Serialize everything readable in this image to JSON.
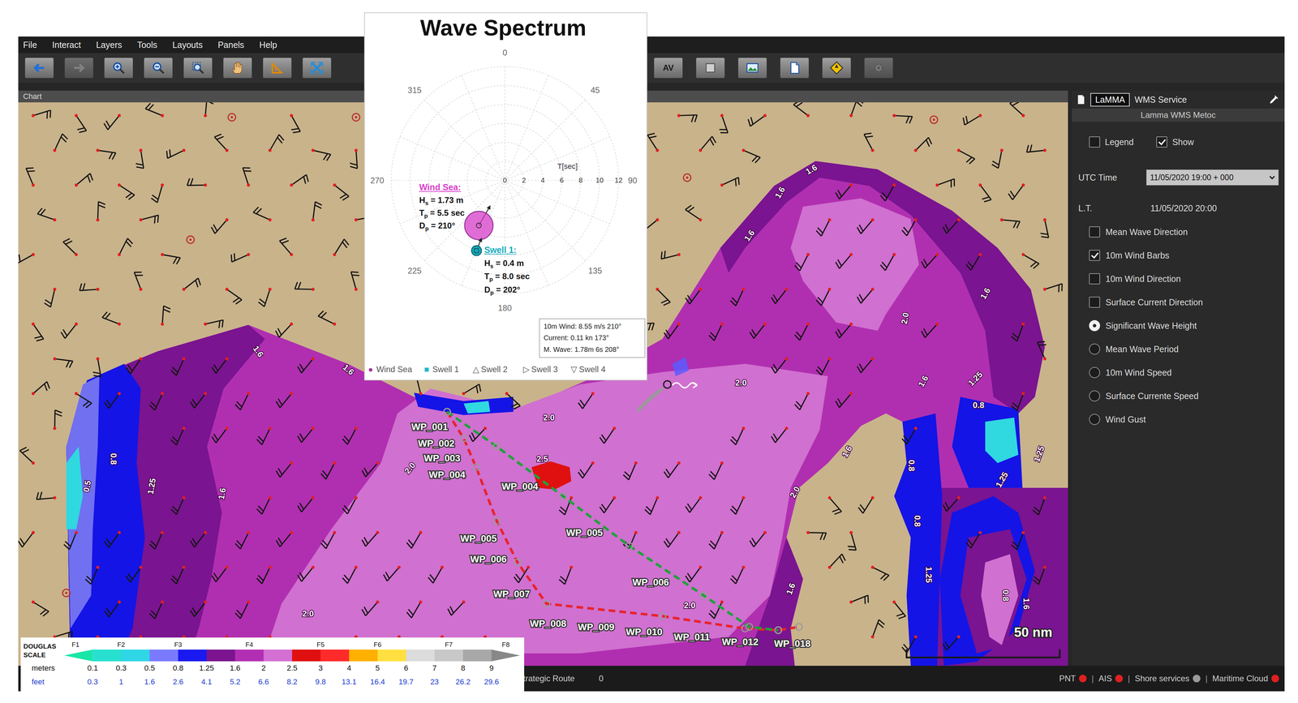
{
  "menu": [
    "File",
    "Interact",
    "Layers",
    "Tools",
    "Layouts",
    "Panels",
    "Help"
  ],
  "toolbar": [
    {
      "kind": "back",
      "disabled": false
    },
    {
      "kind": "forward",
      "disabled": true
    },
    {
      "kind": "zoom-in",
      "disabled": false
    },
    {
      "kind": "zoom-out",
      "disabled": false
    },
    {
      "kind": "zoom-area",
      "disabled": false
    },
    {
      "kind": "pan",
      "disabled": false
    },
    {
      "kind": "measure",
      "disabled": false
    },
    {
      "kind": "fit",
      "disabled": false
    }
  ],
  "toolbar_right": [
    {
      "kind": "label",
      "label": "AV",
      "disabled": false
    },
    {
      "kind": "blank",
      "disabled": false
    },
    {
      "kind": "layer",
      "disabled": false
    },
    {
      "kind": "document",
      "disabled": false
    },
    {
      "kind": "compass",
      "disabled": false
    },
    {
      "kind": "settings",
      "disabled": true
    }
  ],
  "chart": {
    "title": "Chart",
    "scale": "50 nm",
    "contour_labels": [
      "1.6",
      "1.6",
      "1.6",
      "2.0",
      "1.6",
      "1.6",
      "1.6",
      "2.0",
      "1.6",
      "1.25",
      "0.8",
      "2.0",
      "2.5",
      "2.0",
      "0.8",
      "0.5",
      "1.25",
      "1.6",
      "1.6",
      "2.0",
      "1.25",
      "1.25",
      "0.8",
      "0.8",
      "1.6",
      "2.0",
      "1.25",
      "0.8",
      "1.6",
      "2.0"
    ],
    "routes": [
      {
        "color": "#e8232b",
        "waypoints": [
          "WP_001",
          "WP_002",
          "WP_003",
          "WP_004",
          "WP_005",
          "WP_006",
          "WP_007",
          "WP_008",
          "WP_009",
          "WP_010",
          "WP_011",
          "WP_012",
          "WP_018"
        ]
      },
      {
        "color": "#1fa23a",
        "waypoints": [
          "WP_004",
          "WP_005",
          "WP_006"
        ]
      }
    ]
  },
  "wave_spectrum": {
    "title": "Wave Spectrum",
    "directions": [
      "0",
      "45",
      "90",
      "135",
      "180",
      "225",
      "270",
      "315"
    ],
    "period_axis_label": "T[sec]",
    "period_ticks": [
      "0",
      "2",
      "4",
      "6",
      "8",
      "10",
      "12"
    ],
    "components": [
      {
        "name": "Wind Sea:",
        "color": "#d63cc8",
        "params": [
          {
            "symbol": "H",
            "sub": "s",
            "value": " = 1.73 m"
          },
          {
            "symbol": "T",
            "sub": "p",
            "value": " = 5.5 sec"
          },
          {
            "symbol": "D",
            "sub": "p",
            "value": " = 210°"
          }
        ]
      },
      {
        "name": "Swell 1:",
        "color": "#17a9bd",
        "params": [
          {
            "symbol": "H",
            "sub": "s",
            "value": " = 0.4 m"
          },
          {
            "symbol": "T",
            "sub": "p",
            "value": " = 8.0 sec"
          },
          {
            "symbol": "D",
            "sub": "p",
            "value": " = 202°"
          }
        ]
      }
    ],
    "info": [
      "10m Wind: 8.55 m/s 210°",
      "Current: 0.11 kn 173°",
      "M. Wave: 1.78m 6s 208°"
    ],
    "legend": [
      {
        "marker": "●",
        "label": "Wind Sea",
        "color": "#a8329f"
      },
      {
        "marker": "■",
        "label": "Swell 1",
        "color": "#20b8c8"
      },
      {
        "marker": "△",
        "label": "Swell 2",
        "color": "#555555"
      },
      {
        "marker": "▷",
        "label": "Swell 3",
        "color": "#555555"
      },
      {
        "marker": "▽",
        "label": "Swell 4",
        "color": "#555555"
      }
    ]
  },
  "douglas_scale": {
    "title_lines": [
      "DOUGLAS",
      "SCALE"
    ],
    "forces": [
      "F1",
      "F2",
      "F3",
      "F4",
      "F5",
      "F6",
      "F7",
      "F8"
    ],
    "meters_label": "meters",
    "feet_label": "feet",
    "meters": [
      "0.1",
      "0.3",
      "0.5",
      "0.8",
      "1.25",
      "1.6",
      "2",
      "2.5",
      "3",
      "4",
      "5",
      "6",
      "7",
      "8",
      "9"
    ],
    "feet": [
      "0.3",
      "1",
      "1.6",
      "2.6",
      "4.1",
      "5.2",
      "6.6",
      "8.2",
      "9.8",
      "13.1",
      "16.4",
      "19.7",
      "23",
      "26.2",
      "29.6"
    ],
    "bands": [
      {
        "color": "#19e6a8"
      },
      {
        "color": "#27e0cf"
      },
      {
        "color": "#2fd6e6"
      },
      {
        "color": "#7a7aff"
      },
      {
        "color": "#1a1af0"
      },
      {
        "color": "#7c1490"
      },
      {
        "color": "#b22fb4"
      },
      {
        "color": "#d46fd4"
      },
      {
        "color": "#e01010"
      },
      {
        "color": "#ff2a2a"
      },
      {
        "color": "#ffb000"
      },
      {
        "color": "#ffe040"
      },
      {
        "color": "#dcdcdc"
      },
      {
        "color": "#c8c8c8"
      },
      {
        "color": "#a8a8a8"
      },
      {
        "color": "#888888"
      }
    ]
  },
  "side_panel": {
    "tab": "LaMMA",
    "title": "WMS Service",
    "subtitle": "Lamma WMS Metoc",
    "toggles": [
      {
        "label": "Legend",
        "checked": false
      },
      {
        "label": "Show",
        "checked": true
      }
    ],
    "utc_label": "UTC Time",
    "utc_value": "11/05/2020 19:00 + 000",
    "lt_label": "L.T.",
    "lt_value": "11/05/2020 20:00",
    "layers": [
      {
        "label": "Mean Wave Direction",
        "kind": "checkbox",
        "checked": false
      },
      {
        "label": "10m Wind Barbs",
        "kind": "checkbox",
        "checked": true
      },
      {
        "label": "10m Wind Direction",
        "kind": "checkbox",
        "checked": false
      },
      {
        "label": "Surface Current Direction",
        "kind": "checkbox",
        "checked": false
      },
      {
        "label": "Significant Wave Height",
        "kind": "radio",
        "selected": true
      },
      {
        "label": "Mean Wave Period",
        "kind": "radio",
        "selected": false
      },
      {
        "label": "10m Wind Speed",
        "kind": "radio",
        "selected": false
      },
      {
        "label": "Surface Currente Speed",
        "kind": "radio",
        "selected": false
      },
      {
        "label": "Wind Gust",
        "kind": "radio",
        "selected": false
      }
    ]
  },
  "status_bar": {
    "route_label": "trategic Route",
    "route_value": "0",
    "separator": "|",
    "services": [
      {
        "label": "PNT",
        "color": "#e02020"
      },
      {
        "label": "AIS",
        "color": "#e02020"
      },
      {
        "label": "Shore services",
        "color": "#9a9a9a"
      },
      {
        "label": "Maritime Cloud",
        "color": "#e02020"
      }
    ]
  }
}
